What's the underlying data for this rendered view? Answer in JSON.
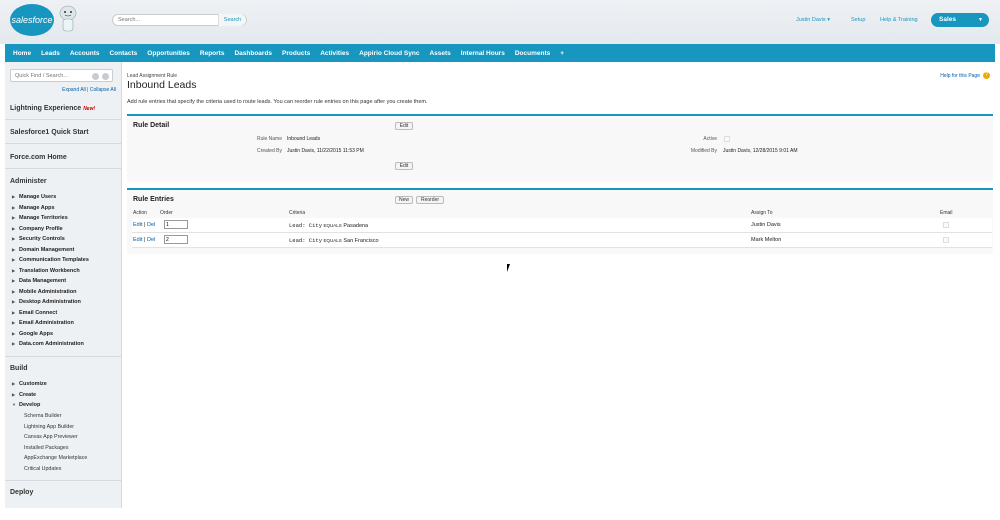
{
  "header": {
    "logo_text": "salesforce",
    "search_placeholder": "Search...",
    "search_button": "Search",
    "user_name": "Justin Davis",
    "setup": "Setup",
    "help_training": "Help & Training",
    "app_name": "Sales",
    "brand_color": "#1797c0"
  },
  "tabs": [
    "Home",
    "Leads",
    "Accounts",
    "Contacts",
    "Opportunities",
    "Reports",
    "Dashboards",
    "Products",
    "Activities",
    "Appirio Cloud Sync",
    "Assets",
    "Internal Hours",
    "Documents",
    "+"
  ],
  "sidebar": {
    "quickfind_placeholder": "Quick Find / Search...",
    "expand_all": "Expand All",
    "collapse_all": "Collapse All",
    "lightning": "Lightning Experience",
    "new_badge": "New!",
    "sf1": "Salesforce1 Quick Start",
    "forcecom": "Force.com Home",
    "administer": "Administer",
    "admin_items": [
      "Manage Users",
      "Manage Apps",
      "Manage Territories",
      "Company Profile",
      "Security Controls",
      "Domain Management",
      "Communication Templates",
      "Translation Workbench",
      "Data Management",
      "Mobile Administration",
      "Desktop Administration",
      "Email Connect",
      "Email Administration",
      "Google Apps",
      "Data.com Administration"
    ],
    "build": "Build",
    "build_items": [
      "Customize",
      "Create",
      "Develop"
    ],
    "develop_sub": [
      "Schema Builder",
      "Lightning App Builder",
      "Canvas App Previewer",
      "Installed Packages",
      "AppExchange Marketplace",
      "Critical Updates"
    ],
    "deploy": "Deploy"
  },
  "page": {
    "breadcrumb": "Lead Assignment Rule",
    "title": "Inbound Leads",
    "help_link": "Help for this Page",
    "description": "Add rule entries that specify the criteria used to route leads. You can reorder rule entries on this page after you create them."
  },
  "rule_detail": {
    "heading": "Rule Detail",
    "edit_button": "Edit",
    "rule_name_label": "Rule Name",
    "rule_name": "Inbound Leads",
    "active_label": "Active",
    "created_by_label": "Created By",
    "created_by_user": "Justin Davis",
    "created_by_date": ", 11/22/2015 11:53 PM",
    "modified_by_label": "Modified By",
    "modified_by_user": "Justin Davis",
    "modified_by_date": ", 12/28/2015 9:01 AM"
  },
  "rule_entries": {
    "heading": "Rule Entries",
    "new_button": "New",
    "reorder_button": "Reorder",
    "columns": {
      "action": "Action",
      "order": "Order",
      "criteria": "Criteria",
      "assign_to": "Assign To",
      "email": "Email"
    },
    "edit_link": "Edit",
    "del_link": "Del",
    "rows": [
      {
        "order": "1",
        "criteria_field": "Lead: City",
        "operator": "EQUALS",
        "value": "Pasadena",
        "assign_to": "Justin Davis"
      },
      {
        "order": "2",
        "criteria_field": "Lead: City",
        "operator": "EQUALS",
        "value": "San Francisco",
        "assign_to": "Mark Melton"
      }
    ]
  }
}
